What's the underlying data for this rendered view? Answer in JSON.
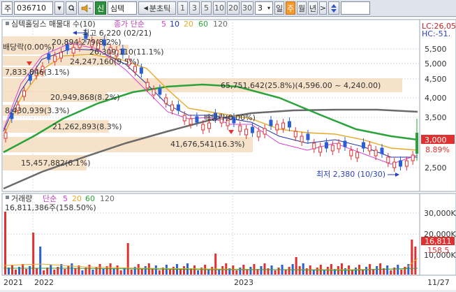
{
  "toolbar": {
    "mode_label": "주",
    "code": "036710",
    "btn_sin": "신",
    "stock_name": "심텍",
    "tick_label": "분초틱",
    "periods": [
      "1",
      "3",
      "5",
      "10",
      "20",
      "30"
    ],
    "count": "3",
    "day_label": "일",
    "week_label": "주",
    "month_label": "월",
    "year_label": "년",
    "prev_glyph": "◀",
    "next_glyph": ">"
  },
  "price_panel": {
    "legend_title": "심텍홀딩스 매물대 수(10)",
    "legend_ma_label": "종가 단순",
    "legend_ma_periods": [
      "5",
      "10",
      "20",
      "60",
      "120"
    ],
    "lc_label": "LC:26,05",
    "hc_label": "HC:-51.",
    "current_price": "3,000",
    "current_pct": "8.89%",
    "y_ticks": [
      "5,500",
      "5,000",
      "4,500",
      "4,000",
      "3,500",
      "2,500"
    ],
    "high_label": "최고 6,220 (02/21)",
    "low_label": "최저 2,380 (10/30)",
    "dividend_labels": [
      "배당락(0.00%)",
      "배당락(0.00%)"
    ],
    "volume_profile": [
      "20,894,279(8.2%)",
      "26,309,110(11.1%)",
      "24,247,160(9.5%)",
      "7,833,846(3.1%)",
      "20,949,868(8.2%)",
      "65,751,642(25.8%)(4,596.00 ~ 4,240.00)",
      "8,430,939(3.3%)",
      "21,262,893(8.3%)",
      "41,676,541(16.3%)",
      "15,457,882(6.1%)"
    ]
  },
  "volume_panel": {
    "legend_title": "거래량",
    "legend_ma_label": "단순",
    "legend_ma_periods": [
      "5",
      "20",
      "60",
      "120"
    ],
    "summary": "16,811,386주(158.50%)",
    "y_ticks": [
      "30,000K",
      "20,000K",
      "10,000K"
    ],
    "current_value": "16,811",
    "current_pct": "158.5"
  },
  "x_axis": {
    "labels": [
      "2021",
      "2022",
      "2023",
      "11/27"
    ]
  },
  "colors": {
    "ma5": "#d63fd6",
    "ma10": "#1f2fa0",
    "ma20": "#e8a92a",
    "ma60": "#2aa33a",
    "ma120": "#6a6a6a",
    "up": "#e03030",
    "down": "#2a5fd6",
    "profile": "#f5dcc0"
  }
}
